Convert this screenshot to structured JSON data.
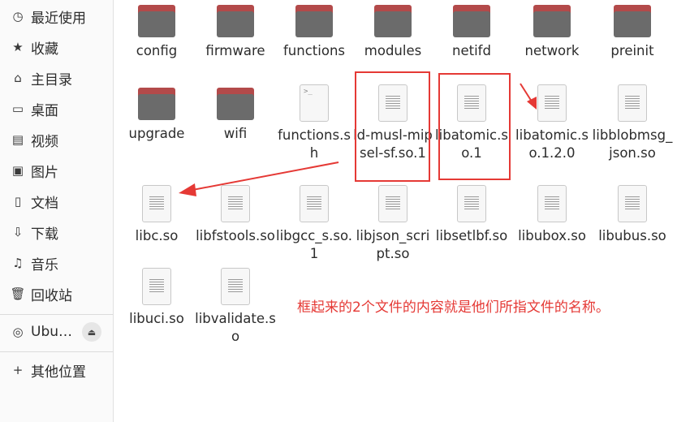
{
  "sidebar": {
    "items": [
      {
        "label": "最近使用",
        "icon": "clock-icon"
      },
      {
        "label": "收藏",
        "icon": "star-icon"
      },
      {
        "label": "主目录",
        "icon": "home-icon"
      },
      {
        "label": "桌面",
        "icon": "desktop-icon"
      },
      {
        "label": "视频",
        "icon": "video-icon"
      },
      {
        "label": "图片",
        "icon": "picture-icon"
      },
      {
        "label": "文档",
        "icon": "document-icon"
      },
      {
        "label": "下载",
        "icon": "download-icon"
      },
      {
        "label": "音乐",
        "icon": "music-icon"
      },
      {
        "label": "回收站",
        "icon": "trash-icon"
      }
    ],
    "drive": {
      "label": "Ubu…",
      "icon": "disc-icon",
      "eject_icon": "eject-icon"
    },
    "other": {
      "label": "其他位置",
      "icon": "plus-icon"
    }
  },
  "files": [
    {
      "name": "config",
      "type": "folder"
    },
    {
      "name": "firmware",
      "type": "folder"
    },
    {
      "name": "functions",
      "type": "folder"
    },
    {
      "name": "modules",
      "type": "folder"
    },
    {
      "name": "netifd",
      "type": "folder"
    },
    {
      "name": "network",
      "type": "folder"
    },
    {
      "name": "preinit",
      "type": "folder"
    },
    {
      "name": "upgrade",
      "type": "folder"
    },
    {
      "name": "wifi",
      "type": "folder"
    },
    {
      "name": "functions.sh",
      "type": "script"
    },
    {
      "name": "ld-musl-mipsel-sf.so.1",
      "type": "file"
    },
    {
      "name": "libatomic.so.1",
      "type": "file"
    },
    {
      "name": "libatomic.so.1.2.0",
      "type": "file"
    },
    {
      "name": "libblobmsg_json.so",
      "type": "file"
    },
    {
      "name": "libc.so",
      "type": "file"
    },
    {
      "name": "libfstools.so",
      "type": "file"
    },
    {
      "name": "libgcc_s.so.1",
      "type": "file"
    },
    {
      "name": "libjson_script.so",
      "type": "file"
    },
    {
      "name": "libsetlbf.so",
      "type": "file"
    },
    {
      "name": "libubox.so",
      "type": "file"
    },
    {
      "name": "libubus.so",
      "type": "file"
    },
    {
      "name": "libuci.so",
      "type": "file"
    },
    {
      "name": "libvalidate.so",
      "type": "file"
    }
  ],
  "annotation": {
    "text": "框起来的2个文件的内容就是他们所指文件的名称。",
    "color": "#e53935"
  }
}
